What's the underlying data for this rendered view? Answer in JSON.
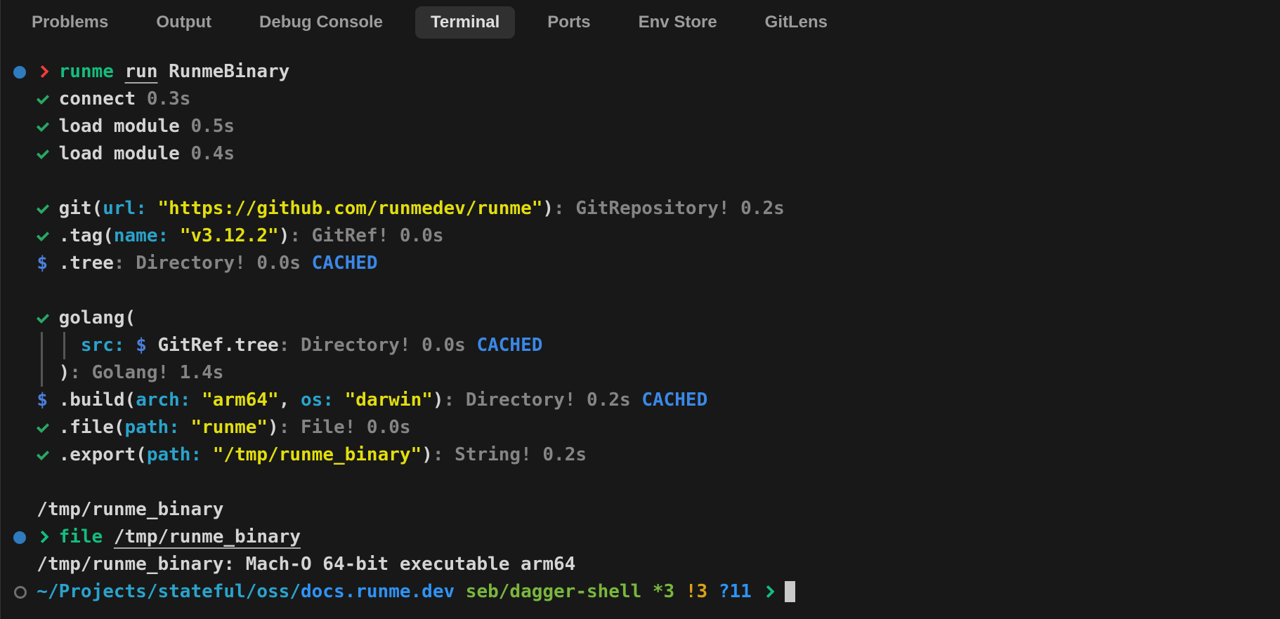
{
  "tabs": {
    "active_tab": "Terminal",
    "items": [
      {
        "label": "Problems"
      },
      {
        "label": "Output"
      },
      {
        "label": "Debug Console"
      },
      {
        "label": "Terminal"
      },
      {
        "label": "Ports"
      },
      {
        "label": "Env Store"
      },
      {
        "label": "GitLens"
      }
    ]
  },
  "colors": {
    "background": "#181818",
    "active_tab_background": "#303031",
    "foreground_white": "#d4d4d4",
    "foreground_gray": "#858585",
    "command_green": "#14bd7e",
    "check_green": "#2aa665",
    "arg_cyan": "#2aa3cc",
    "string_yellow": "#e2de0e",
    "dollar_blue": "#4a80dd",
    "cached_blue": "#3b88e8",
    "repo_blue": "#2f93f5",
    "branch_lime": "#7ab73e",
    "dirty_orange": "#d9a118",
    "prompt_red": "#ef3b3b",
    "status_dot_blue": "#2e7bbf",
    "cursor_gray": "#c9c9c9"
  },
  "terminal": {
    "lines": [
      {
        "name": "command-line-runme",
        "segments": [
          {
            "icon": "dot",
            "name": "status-dot-icon"
          },
          {
            "text": " "
          },
          {
            "icon": "chevron",
            "style": "red",
            "name": "prompt-chevron-icon"
          },
          {
            "text": " "
          },
          {
            "text": "runme",
            "style": "green"
          },
          {
            "text": " "
          },
          {
            "text": "run",
            "style": "white underline"
          },
          {
            "text": " RunmeBinary",
            "style": "white"
          }
        ]
      },
      {
        "name": "step-connect",
        "segments": [
          {
            "text": "  "
          },
          {
            "icon": "check",
            "name": "check-icon"
          },
          {
            "text": " connect",
            "style": "white"
          },
          {
            "text": " 0.3s",
            "style": "gray"
          }
        ]
      },
      {
        "name": "step-load-module-1",
        "segments": [
          {
            "text": "  "
          },
          {
            "icon": "check",
            "name": "check-icon"
          },
          {
            "text": " load module",
            "style": "white"
          },
          {
            "text": " 0.5s",
            "style": "gray"
          }
        ]
      },
      {
        "name": "step-load-module-2",
        "segments": [
          {
            "text": "  "
          },
          {
            "icon": "check",
            "name": "check-icon"
          },
          {
            "text": " load module",
            "style": "white"
          },
          {
            "text": " 0.4s",
            "style": "gray"
          }
        ]
      },
      {
        "name": "blank-line",
        "segments": []
      },
      {
        "name": "step-git",
        "segments": [
          {
            "text": "  "
          },
          {
            "icon": "check",
            "name": "check-icon"
          },
          {
            "text": " git(",
            "style": "white"
          },
          {
            "text": "url:",
            "style": "cyan"
          },
          {
            "text": " "
          },
          {
            "text": "\"https://github.com/runmedev/runme\"",
            "style": "yellow"
          },
          {
            "text": ")",
            "style": "white"
          },
          {
            "text": ": GitRepository! 0.2s",
            "style": "gray"
          }
        ]
      },
      {
        "name": "step-tag",
        "segments": [
          {
            "text": "  "
          },
          {
            "icon": "check",
            "name": "check-icon"
          },
          {
            "text": " .tag(",
            "style": "white"
          },
          {
            "text": "name:",
            "style": "cyan"
          },
          {
            "text": " "
          },
          {
            "text": "\"v3.12.2\"",
            "style": "yellow"
          },
          {
            "text": ")",
            "style": "white"
          },
          {
            "text": ": GitRef! 0.0s",
            "style": "gray"
          }
        ]
      },
      {
        "name": "step-tree",
        "segments": [
          {
            "text": "  "
          },
          {
            "text": "$",
            "style": "blue"
          },
          {
            "text": " .tree",
            "style": "white"
          },
          {
            "text": ": Directory! 0.0s ",
            "style": "gray"
          },
          {
            "text": "CACHED",
            "style": "cache"
          }
        ]
      },
      {
        "name": "blank-line",
        "segments": []
      },
      {
        "name": "step-golang-open",
        "segments": [
          {
            "text": "  "
          },
          {
            "icon": "check",
            "name": "check-icon"
          },
          {
            "text": " golang(",
            "style": "white"
          }
        ]
      },
      {
        "name": "step-golang-src",
        "segments": [
          {
            "text": "  "
          },
          {
            "icon": "vbar",
            "name": "tree-bar-icon"
          },
          {
            "text": " "
          },
          {
            "icon": "vbar",
            "name": "tree-bar-icon"
          },
          {
            "text": " "
          },
          {
            "text": "src:",
            "style": "cyan"
          },
          {
            "text": " "
          },
          {
            "text": "$",
            "style": "blue"
          },
          {
            "text": " GitRef.tree",
            "style": "white"
          },
          {
            "text": ": Directory! 0.0s ",
            "style": "gray"
          },
          {
            "text": "CACHED",
            "style": "cache"
          }
        ]
      },
      {
        "name": "step-golang-close",
        "segments": [
          {
            "text": "  "
          },
          {
            "icon": "vbar",
            "name": "tree-bar-icon"
          },
          {
            "text": " )",
            "style": "white"
          },
          {
            "text": ": Golang! 1.4s",
            "style": "gray"
          }
        ]
      },
      {
        "name": "step-build",
        "segments": [
          {
            "text": "  "
          },
          {
            "text": "$",
            "style": "blue"
          },
          {
            "text": " .build(",
            "style": "white"
          },
          {
            "text": "arch:",
            "style": "cyan"
          },
          {
            "text": " "
          },
          {
            "text": "\"arm64\"",
            "style": "yellow"
          },
          {
            "text": ", ",
            "style": "white"
          },
          {
            "text": "os:",
            "style": "cyan"
          },
          {
            "text": " "
          },
          {
            "text": "\"darwin\"",
            "style": "yellow"
          },
          {
            "text": ")",
            "style": "white"
          },
          {
            "text": ": Directory! 0.2s ",
            "style": "gray"
          },
          {
            "text": "CACHED",
            "style": "cache"
          }
        ]
      },
      {
        "name": "step-file",
        "segments": [
          {
            "text": "  "
          },
          {
            "icon": "check",
            "name": "check-icon"
          },
          {
            "text": " .file(",
            "style": "white"
          },
          {
            "text": "path:",
            "style": "cyan"
          },
          {
            "text": " "
          },
          {
            "text": "\"runme\"",
            "style": "yellow"
          },
          {
            "text": ")",
            "style": "white"
          },
          {
            "text": ": File! 0.0s",
            "style": "gray"
          }
        ]
      },
      {
        "name": "step-export",
        "segments": [
          {
            "text": "  "
          },
          {
            "icon": "check",
            "name": "check-icon"
          },
          {
            "text": " .export(",
            "style": "white"
          },
          {
            "text": "path:",
            "style": "cyan"
          },
          {
            "text": " "
          },
          {
            "text": "\"/tmp/runme_binary\"",
            "style": "yellow"
          },
          {
            "text": ")",
            "style": "white"
          },
          {
            "text": ": String! 0.2s",
            "style": "gray"
          }
        ]
      },
      {
        "name": "blank-line",
        "segments": []
      },
      {
        "name": "output-binary-path",
        "segments": [
          {
            "text": "  /tmp/runme_binary",
            "style": "white"
          }
        ]
      },
      {
        "name": "command-line-file",
        "segments": [
          {
            "icon": "dot",
            "name": "status-dot-icon"
          },
          {
            "text": " "
          },
          {
            "icon": "chevron",
            "style": "green",
            "name": "prompt-chevron-icon"
          },
          {
            "text": " "
          },
          {
            "text": "file",
            "style": "green"
          },
          {
            "text": " "
          },
          {
            "text": "/tmp/runme_binary",
            "style": "white underline"
          }
        ]
      },
      {
        "name": "output-file-type",
        "segments": [
          {
            "text": "  /tmp/runme_binary: Mach-O 64-bit executable arm64",
            "style": "white"
          }
        ]
      },
      {
        "name": "shell-prompt",
        "segments": [
          {
            "icon": "ring",
            "name": "pending-ring-icon"
          },
          {
            "text": " "
          },
          {
            "text": "~/Projects/stateful/oss/",
            "style": "cyan"
          },
          {
            "text": "docs.runme.dev",
            "style": "blue2"
          },
          {
            "text": " "
          },
          {
            "text": "seb/dagger-shell *3",
            "style": "lime"
          },
          {
            "text": " !3",
            "style": "orange"
          },
          {
            "text": " ?11",
            "style": "blue2"
          },
          {
            "text": " "
          },
          {
            "icon": "chevron",
            "style": "green",
            "name": "prompt-chevron-icon"
          },
          {
            "text": " "
          },
          {
            "icon": "cursor",
            "name": "terminal-cursor"
          }
        ]
      }
    ]
  }
}
